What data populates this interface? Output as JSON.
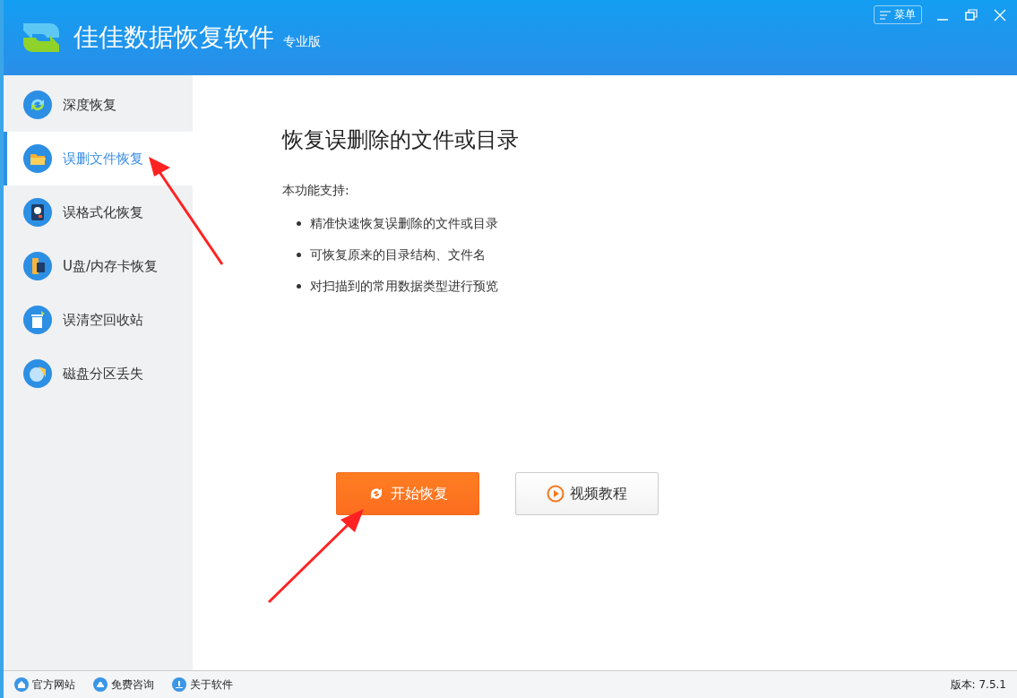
{
  "window": {
    "title": "佳佳数据恢复软件",
    "edition": "专业版",
    "menu_label": "菜单"
  },
  "sidebar": {
    "items": [
      {
        "label": "深度恢复",
        "kind": "sync",
        "selected": false
      },
      {
        "label": "误删文件恢复",
        "kind": "folder",
        "selected": true
      },
      {
        "label": "误格式化恢复",
        "kind": "disk",
        "selected": false
      },
      {
        "label": "U盘/内存卡恢复",
        "kind": "usb",
        "selected": false
      },
      {
        "label": "误清空回收站",
        "kind": "trash",
        "selected": false
      },
      {
        "label": "磁盘分区丢失",
        "kind": "pie",
        "selected": false
      }
    ]
  },
  "main": {
    "heading": "恢复误删除的文件或目录",
    "intro": "本功能支持:",
    "features": [
      "精准快速恢复误删除的文件或目录",
      "可恢复原来的目录结构、文件名",
      "对扫描到的常用数据类型进行预览"
    ],
    "buttons": [
      {
        "label": "开始恢复",
        "kind": "primary"
      },
      {
        "label": "视频教程",
        "kind": "secondary"
      }
    ]
  },
  "status_bar": {
    "links": [
      {
        "label": "官方网站",
        "kind": "home"
      },
      {
        "label": "免费咨询",
        "kind": "chat"
      },
      {
        "label": "关于软件",
        "kind": "info"
      }
    ],
    "version": "版本: 7.5.1"
  }
}
